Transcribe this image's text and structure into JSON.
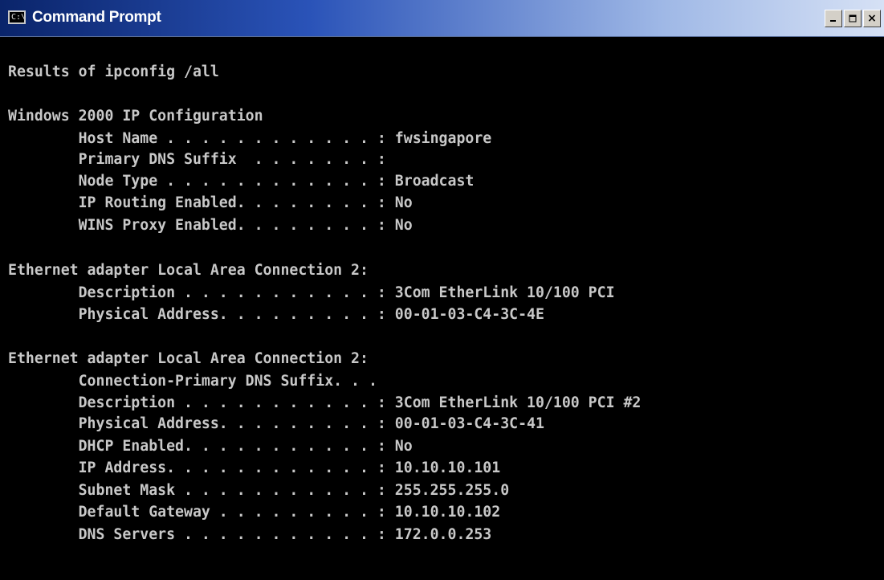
{
  "window": {
    "title": "Command Prompt",
    "icon": "console-app-icon",
    "icon_glyph": "C:\\",
    "controls": {
      "minimize_icon": "minimize-icon",
      "maximize_icon": "maximize-icon",
      "close_icon": "close-icon",
      "close_glyph": "×"
    }
  },
  "console": {
    "lines": [
      "Results of ipconfig /all",
      "Windows 2000 IP Configuration",
      "        Host Name . . . . . . . . . . . . : fwsingapore",
      "        Primary DNS Suffix  . . . . . . . :",
      "        Node Type . . . . . . . . . . . . : Broadcast",
      "        IP Routing Enabled. . . . . . . . : No",
      "        WINS Proxy Enabled. . . . . . . . : No",
      "Ethernet adapter Local Area Connection 2:",
      "        Description . . . . . . . . . . . : 3Com EtherLink 10/100 PCI",
      "        Physical Address. . . . . . . . . : 00-01-03-C4-3C-4E",
      "Ethernet adapter Local Area Connection 2:",
      "        Connection-Primary DNS Suffix. . .",
      "        Description . . . . . . . . . . . : 3Com EtherLink 10/100 PCI #2",
      "        Physical Address. . . . . . . . . : 00-01-03-C4-3C-41",
      "        DHCP Enabled. . . . . . . . . . . : No",
      "        IP Address. . . . . . . . . . . . : 10.10.10.101",
      "        Subnet Mask . . . . . . . . . . . : 255.255.255.0",
      "        Default Gateway . . . . . . . . . : 10.10.10.102",
      "        DNS Servers . . . . . . . . . . . : 172.0.0.253"
    ]
  },
  "colors": {
    "titlebar_start": "#0a246a",
    "titlebar_end": "#d6e1f5",
    "console_background": "#000000",
    "console_text": "#c8c8c8"
  }
}
